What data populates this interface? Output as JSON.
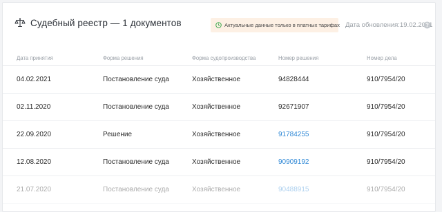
{
  "header": {
    "title": "Судебный реестр — 1 документов",
    "notice": "Актуальные данные только в платных тарифах",
    "updated": "Дата обновления:19.02.2021"
  },
  "columns": [
    "Дата принятия",
    "Форма решения",
    "Форма судопроизводства",
    "Номер решения",
    "Номер дела"
  ],
  "rows": [
    {
      "date": "04.02.2021",
      "form": "Постановление суда",
      "proceeding": "Хозяйственное",
      "number": "94828444",
      "case": "910/7954/20"
    },
    {
      "date": "02.11.2020",
      "form": "Постановление суда",
      "proceeding": "Хозяйственное",
      "number": "92671907",
      "case": "910/7954/20"
    },
    {
      "date": "22.09.2020",
      "form": "Решение",
      "proceeding": "Хозяйственное",
      "number": "91784255",
      "case": "910/7954/20"
    },
    {
      "date": "12.08.2020",
      "form": "Постановление суда",
      "proceeding": "Хозяйственное",
      "number": "90909192",
      "case": "910/7954/20"
    },
    {
      "date": "21.07.2020",
      "form": "Постановление суда",
      "proceeding": "Хозяйственное",
      "number": "90488915",
      "case": "910/7954/20"
    }
  ],
  "colors": {
    "link": "#2f88d6",
    "notice_bg": "#fdf0e4",
    "notice_icon": "#37a74a"
  },
  "icons": {
    "title": "scales-icon",
    "notice": "clock-icon",
    "help": "question-icon"
  }
}
